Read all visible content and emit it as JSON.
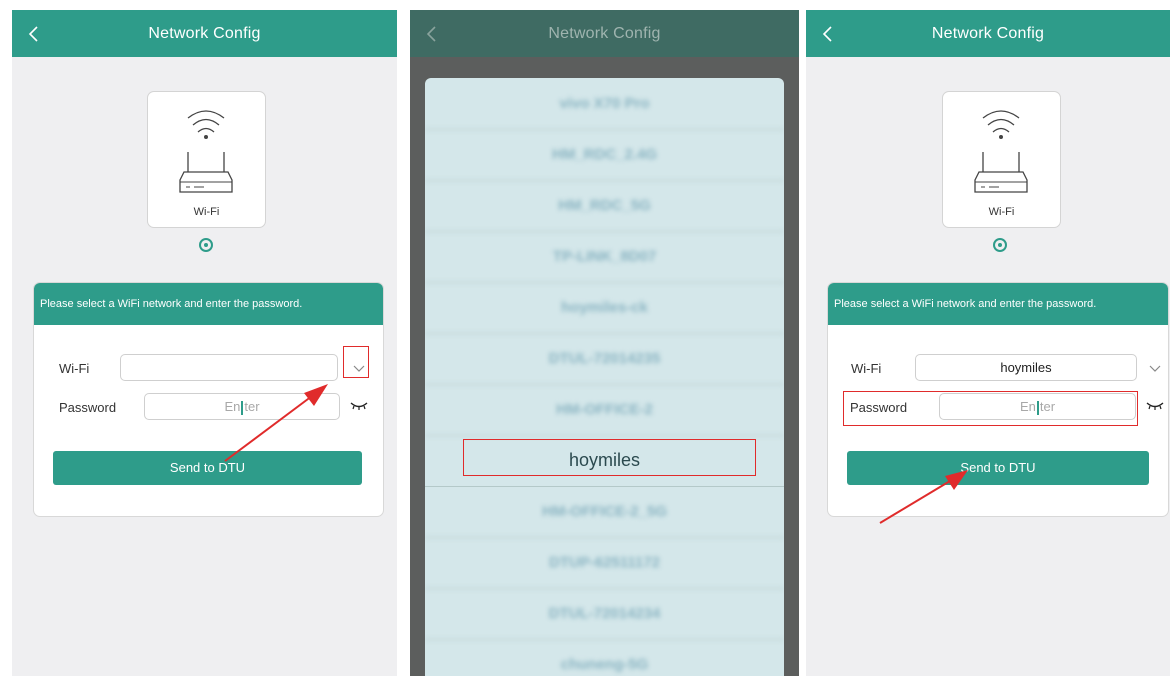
{
  "header": {
    "title": "Network Config"
  },
  "device": {
    "label": "Wi-Fi"
  },
  "form": {
    "instruction": "Please select a WiFi network and enter the password.",
    "wifi_label": "Wi-Fi",
    "password_label": "Password",
    "password_placeholder_before": "En",
    "password_placeholder_after": "ter",
    "send_button": "Send to DTU"
  },
  "step3": {
    "wifi_value": "hoymiles"
  },
  "wifi_list": {
    "items": [
      "vivo X70 Pro",
      "HM_RDC_2.4G",
      "HM_RDC_5G",
      "TP-LINK_8D07",
      "hoymiles-ck",
      "DTUL-72014235",
      "HM-OFFICE-2",
      "hoymiles",
      "HM-OFFICE-2_5G",
      "DTUP-62511172",
      "DTUL-72014234",
      "chuneng-5G"
    ],
    "selected": "hoymiles"
  },
  "colors": {
    "accent": "#2e9c8a",
    "highlight_red": "#e02b2b",
    "background": "#efeff1"
  },
  "icons": {
    "back": "chevron-left-icon",
    "router": "wifi-router-icon",
    "dropdown": "chevron-down-icon",
    "password_toggle": "eye-closed-icon"
  }
}
